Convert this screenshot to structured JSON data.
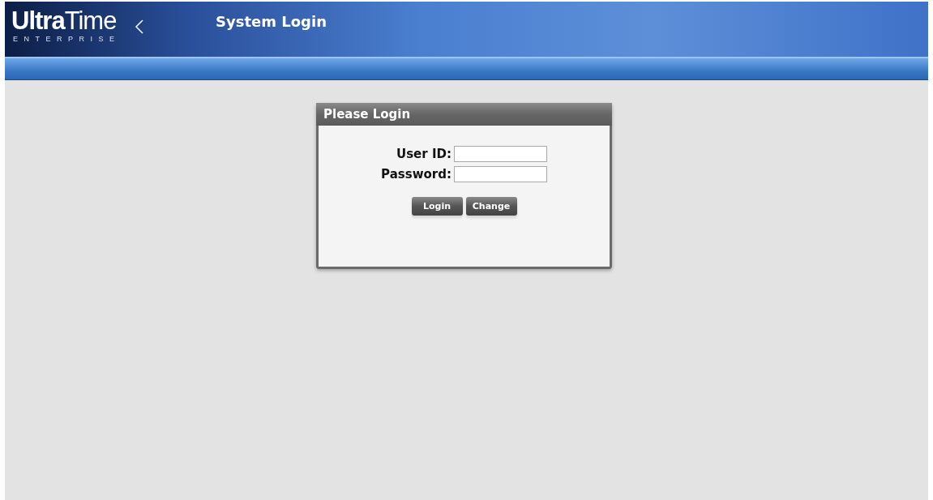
{
  "header": {
    "logo": "**Ultra**Time",
    "logo_subtitle": "ENTERPRISE",
    "title": "System Login"
  },
  "login": {
    "title": "Please Login",
    "fields": [
      {
        "label": "User ID:"
      },
      {
        "label": "Password:"
      }
    ],
    "buttons": [
      "Login",
      "Change"
    ]
  }
}
